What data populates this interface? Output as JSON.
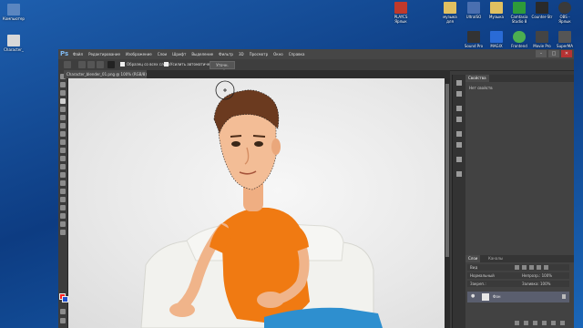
{
  "desktop": {
    "icons": [
      {
        "label": "Компьютер",
        "color": "#5b86c0"
      },
      {
        "label": "Character_",
        "color": "#d8d8d8"
      },
      {
        "label": "PLAYCS Ярлык",
        "color": "#c0392b"
      },
      {
        "label": "музыка для",
        "color": "#e0c060"
      },
      {
        "label": "UltraISO",
        "color": "#4a6fb0"
      },
      {
        "label": "Музыка",
        "color": "#e0c060"
      },
      {
        "label": "Camtasia Studio 8",
        "color": "#2e9b3a"
      },
      {
        "label": "Counter-Str",
        "color": "#2a2a2a"
      },
      {
        "label": "OBS - Ярлык",
        "color": "#3a3a3a"
      },
      {
        "label": "Sound Pro",
        "color": "#333333"
      },
      {
        "label": "MAGIX",
        "color": "#2a6bd6"
      },
      {
        "label": "Frontend",
        "color": "#4caf50"
      },
      {
        "label": "Movie Pro",
        "color": "#444444"
      },
      {
        "label": "SuperMA",
        "color": "#555555"
      }
    ]
  },
  "photoshop": {
    "logo": "Ps",
    "menus": [
      "Файл",
      "Редактирование",
      "Изображение",
      "Слои",
      "Шрифт",
      "Выделение",
      "Фильтр",
      "3D",
      "Просмотр",
      "Окно",
      "Справка"
    ],
    "window_controls": {
      "minimize": "–",
      "maximize": "□",
      "close": "✕"
    },
    "options": {
      "sample_all_layers": "Образец со всех слоев",
      "auto_enhance": "Усилить автоматически",
      "refine_edge": "Уточн. край..."
    },
    "document_tab": "Character_blender_01.png @ 100% (RGB/8) ×",
    "panels": {
      "properties_tab": "Свойства",
      "no_properties": "Нет свойств",
      "layers_tab": "Слои",
      "channels_tab": "Каналы",
      "layer_kind": "Вид",
      "blend_mode": "Нормальный",
      "opacity_label": "Непрозр.: 100%",
      "fill_label": "Заливка: 100%",
      "lock_label": "Закреп.:",
      "layer_name": "Фон",
      "eye": "●"
    }
  },
  "colors": {
    "foreground": "#ff2020",
    "background": "#1f4fcf",
    "shirt": "#f07a12",
    "jeans": "#2e8fcf"
  }
}
